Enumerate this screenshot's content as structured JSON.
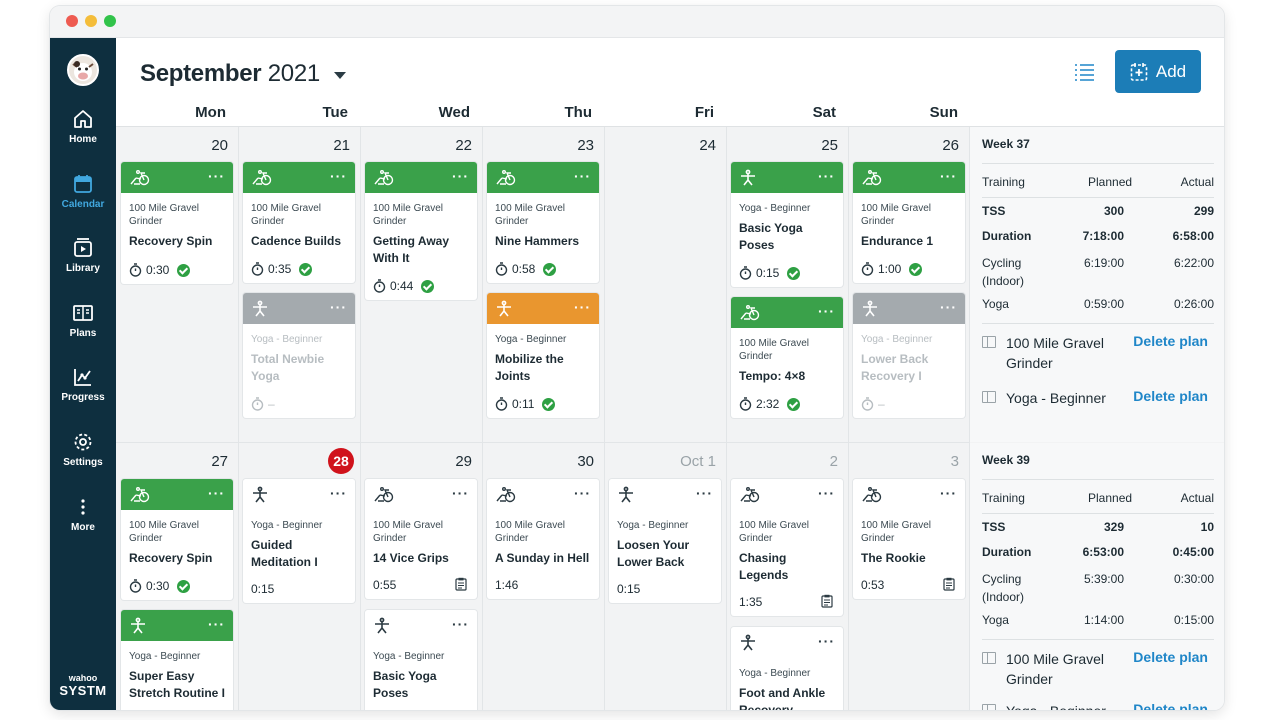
{
  "sidebar": {
    "items": [
      {
        "label": "Home",
        "icon": "home-icon"
      },
      {
        "label": "Calendar",
        "icon": "calendar-icon",
        "active": true
      },
      {
        "label": "Library",
        "icon": "library-icon"
      },
      {
        "label": "Plans",
        "icon": "plans-icon"
      },
      {
        "label": "Progress",
        "icon": "progress-icon"
      },
      {
        "label": "Settings",
        "icon": "gear-icon"
      },
      {
        "label": "More",
        "icon": "more-vertical-icon"
      }
    ],
    "brand_small": "wahoo",
    "brand_big": "SYSTM"
  },
  "header": {
    "month": "September",
    "year": "2021",
    "add_label": "Add"
  },
  "days": [
    "Mon",
    "Tue",
    "Wed",
    "Thu",
    "Fri",
    "Sat",
    "Sun"
  ],
  "week1": {
    "dates": [
      "20",
      "21",
      "22",
      "23",
      "24",
      "25",
      "26"
    ],
    "cards": [
      {
        "plan": "100 Mile Gravel Grinder",
        "title": "Recovery Spin",
        "time": "0:30"
      },
      {
        "plan": "100 Mile Gravel Grinder",
        "title": "Cadence Builds",
        "time": "0:35"
      },
      {
        "plan": "Yoga - Beginner",
        "title": "Total Newbie Yoga",
        "time": "–"
      },
      {
        "plan": "100 Mile Gravel Grinder",
        "title": "Getting Away With It",
        "time": "0:44"
      },
      {
        "plan": "100 Mile Gravel Grinder",
        "title": "Nine Hammers",
        "time": "0:58"
      },
      {
        "plan": "Yoga - Beginner",
        "title": "Mobilize the Joints",
        "time": "0:11"
      },
      {
        "plan": "Yoga - Beginner",
        "title": "Basic Yoga Poses",
        "time": "0:15"
      },
      {
        "plan": "100 Mile Gravel Grinder",
        "title": "Tempo: 4×8",
        "time": "2:32"
      },
      {
        "plan": "100 Mile Gravel Grinder",
        "title": "Endurance 1",
        "time": "1:00"
      },
      {
        "plan": "Yoga - Beginner",
        "title": "Lower Back Recovery I",
        "time": "–"
      }
    ]
  },
  "week2": {
    "dates": [
      "27",
      "28",
      "29",
      "30",
      "Oct 1",
      "2",
      "3"
    ],
    "cards": [
      {
        "plan": "100 Mile Gravel Grinder",
        "title": "Recovery Spin",
        "time": "0:30"
      },
      {
        "plan": "Yoga - Beginner",
        "title": "Super Easy Stretch Routine I",
        "time": ""
      },
      {
        "plan": "Yoga - Beginner",
        "title": "Guided Meditation I",
        "time": "0:15"
      },
      {
        "plan": "100 Mile Gravel Grinder",
        "title": "14 Vice Grips",
        "time": "0:55"
      },
      {
        "plan": "Yoga - Beginner",
        "title": "Basic Yoga Poses",
        "time": ""
      },
      {
        "plan": "100 Mile Gravel Grinder",
        "title": "A Sunday in Hell",
        "time": "1:46"
      },
      {
        "plan": "Yoga - Beginner",
        "title": "Loosen Your Lower Back",
        "time": "0:15"
      },
      {
        "plan": "100 Mile Gravel Grinder",
        "title": "Chasing Legends",
        "time": "1:35"
      },
      {
        "plan": "Yoga - Beginner",
        "title": "Foot and Ankle Recovery",
        "time": ""
      },
      {
        "plan": "100 Mile Gravel Grinder",
        "title": "The Rookie",
        "time": "0:53"
      }
    ]
  },
  "summary": {
    "col_training": "Training",
    "col_planned": "Planned",
    "col_actual": "Actual",
    "delete_label": "Delete plan",
    "weeks": [
      {
        "title": "Week 37",
        "rows": [
          {
            "label": "TSS",
            "planned": "300",
            "actual": "299"
          },
          {
            "label": "Duration",
            "planned": "7:18:00",
            "actual": "6:58:00"
          },
          {
            "label": "Cycling (Indoor)",
            "planned": "6:19:00",
            "actual": "6:22:00"
          },
          {
            "label": "Yoga",
            "planned": "0:59:00",
            "actual": "0:26:00"
          }
        ],
        "plans": [
          "100 Mile Gravel Grinder",
          "Yoga - Beginner"
        ]
      },
      {
        "title": "Week 39",
        "rows": [
          {
            "label": "TSS",
            "planned": "329",
            "actual": "10"
          },
          {
            "label": "Duration",
            "planned": "6:53:00",
            "actual": "0:45:00"
          },
          {
            "label": "Cycling (Indoor)",
            "planned": "5:39:00",
            "actual": "0:30:00"
          },
          {
            "label": "Yoga",
            "planned": "1:14:00",
            "actual": "0:15:00"
          }
        ],
        "plans": [
          "100 Mile Gravel Grinder",
          "Yoga - Beginner"
        ]
      }
    ]
  }
}
